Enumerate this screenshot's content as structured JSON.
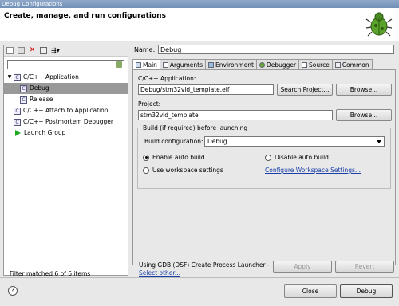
{
  "window": {
    "title": "Debug Configurations"
  },
  "banner": {
    "title": "Create, manage, and run configurations"
  },
  "tree": {
    "items": [
      {
        "label": "C/C++ Application",
        "level": 0,
        "expanded": true
      },
      {
        "label": "Debug",
        "level": 1,
        "selected": true
      },
      {
        "label": "Release",
        "level": 1
      },
      {
        "label": "C/C++ Attach to Application",
        "level": 0
      },
      {
        "label": "C/C++ Postmortem Debugger",
        "level": 0
      },
      {
        "label": "Launch Group",
        "level": 0
      }
    ],
    "filter_status": "Filter matched 6 of 6 items"
  },
  "config": {
    "name_label": "Name:",
    "name_value": "Debug",
    "tabs": [
      "Main",
      "Arguments",
      "Environment",
      "Debugger",
      "Source",
      "Common"
    ],
    "app_label": "C/C++ Application:",
    "app_value": "Debug/stm32vld_template.elf",
    "search_project": "Search Project...",
    "browse": "Browse...",
    "project_label": "Project:",
    "project_value": "stm32vld_template",
    "build_group": "Build (if required) before launching",
    "build_config_label": "Build configuration:",
    "build_config_value": "Debug",
    "enable_auto_build": "Enable auto build",
    "disable_auto_build": "Disable auto build",
    "use_workspace": "Use workspace settings",
    "configure_workspace": "Configure Workspace Settings...",
    "launcher_text": "Using GDB (DSF) Create Process Launcher -",
    "select_other": "Select other...",
    "apply": "Apply",
    "revert": "Revert"
  },
  "footer": {
    "help": "?",
    "close": "Close",
    "debug": "Debug"
  }
}
